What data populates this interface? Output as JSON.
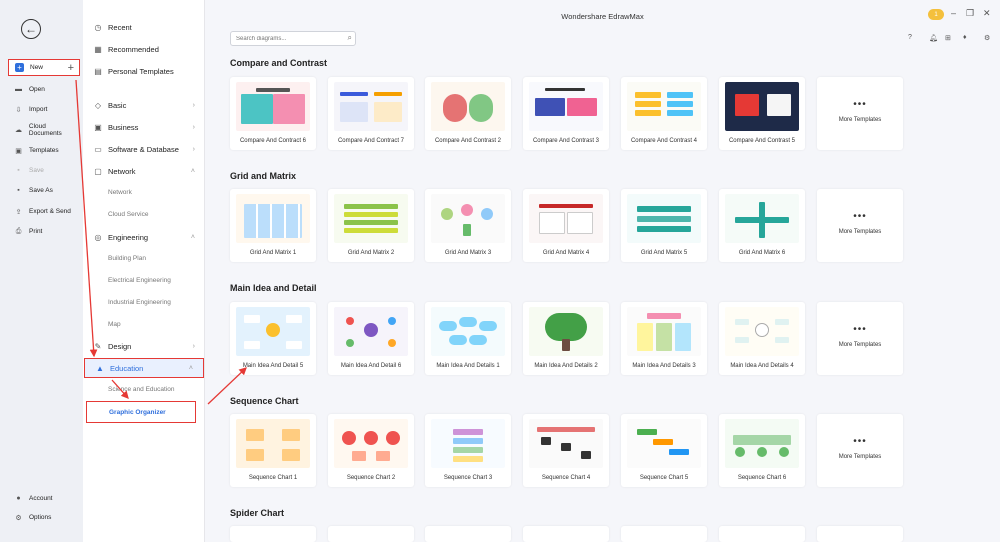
{
  "window": {
    "title": "Wondershare EdrawMax",
    "badge": "1"
  },
  "left_nav": {
    "new": "New",
    "open": "Open",
    "import": "Import",
    "cloud": "Cloud Documents",
    "templates": "Templates",
    "save": "Save",
    "save_as": "Save As",
    "export": "Export & Send",
    "print": "Print",
    "account": "Account",
    "options": "Options"
  },
  "categories": {
    "recent": "Recent",
    "recommended": "Recommended",
    "personal": "Personal Templates",
    "basic": "Basic",
    "business": "Business",
    "software": "Software & Database",
    "network": "Network",
    "network_sub1": "Network",
    "network_sub2": "Cloud Service",
    "engineering": "Engineering",
    "eng_sub1": "Building Plan",
    "eng_sub2": "Electrical Engineering",
    "eng_sub3": "Industrial Engineering",
    "eng_sub4": "Map",
    "design": "Design",
    "education": "Education",
    "edu_sub1": "Science and Education",
    "edu_sub2": "Graphic Organizer"
  },
  "search": {
    "placeholder": "Search diagrams..."
  },
  "more_label": "More Templates",
  "sections": [
    {
      "title": "Compare and Contrast",
      "cards": [
        "Compare And Contract 6",
        "Compare And Contract 7",
        "Compare And Contrast 2",
        "Compare And Contrast 3",
        "Compare And Contrast 4",
        "Compare And Contrast 5"
      ]
    },
    {
      "title": "Grid and Matrix",
      "cards": [
        "Grid And Matrix 1",
        "Grid And Matrix 2",
        "Grid And Matrix 3",
        "Grid And Matrix 4",
        "Grid And Matrix 5",
        "Grid And Matrix 6"
      ]
    },
    {
      "title": "Main Idea and Detail",
      "cards": [
        "Main Idea And Detail 5",
        "Main Idea And Detail 6",
        "Main Idea And Details 1",
        "Main Idea And Details 2",
        "Main Idea And Details 3",
        "Main Idea And Details 4"
      ]
    },
    {
      "title": "Sequence Chart",
      "cards": [
        "Sequence Chart 1",
        "Sequence Chart 2",
        "Sequence Chart 3",
        "Sequence Chart 4",
        "Sequence Chart 5",
        "Sequence Chart 6"
      ]
    },
    {
      "title": "Spider Chart",
      "cards": []
    }
  ],
  "colors": {
    "accent": "#2f6fdc",
    "highlight": "#e53935"
  }
}
